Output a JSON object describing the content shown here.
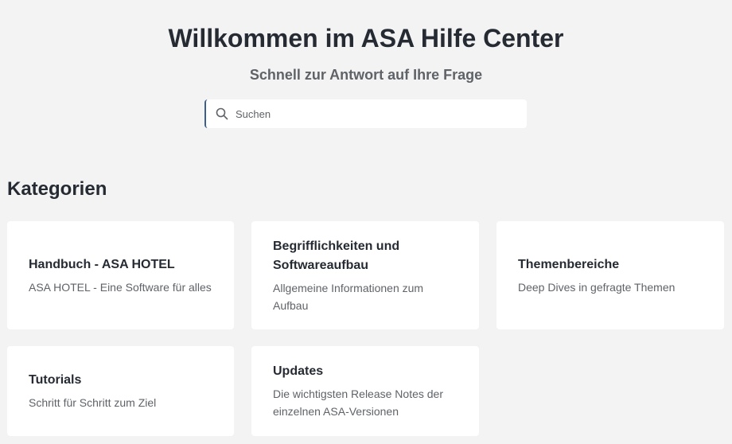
{
  "hero": {
    "title": "Willkommen im ASA Hilfe Center",
    "subtitle": "Schnell zur Antwort auf Ihre Frage"
  },
  "search": {
    "placeholder": "Suchen",
    "value": "",
    "icon": "search-icon"
  },
  "categories": {
    "heading": "Kategorien",
    "items": [
      {
        "title": "Handbuch - ASA HOTEL",
        "description": "ASA HOTEL - Eine Software für alles"
      },
      {
        "title": "Begrifflichkeiten und Softwareaufbau",
        "description": "Allgemeine Informationen zum Aufbau"
      },
      {
        "title": "Themenbereiche",
        "description": "Deep Dives in gefragte Themen"
      },
      {
        "title": "Tutorials",
        "description": "Schritt für Schritt zum Ziel"
      },
      {
        "title": "Updates",
        "description": "Die wichtigsten Release Notes der einzelnen ASA-Versionen"
      }
    ]
  },
  "colors": {
    "background": "#f3f3f3",
    "card": "#ffffff",
    "heading": "#262b33",
    "muted": "#5f6368",
    "search_accent": "#3a5f8f"
  }
}
